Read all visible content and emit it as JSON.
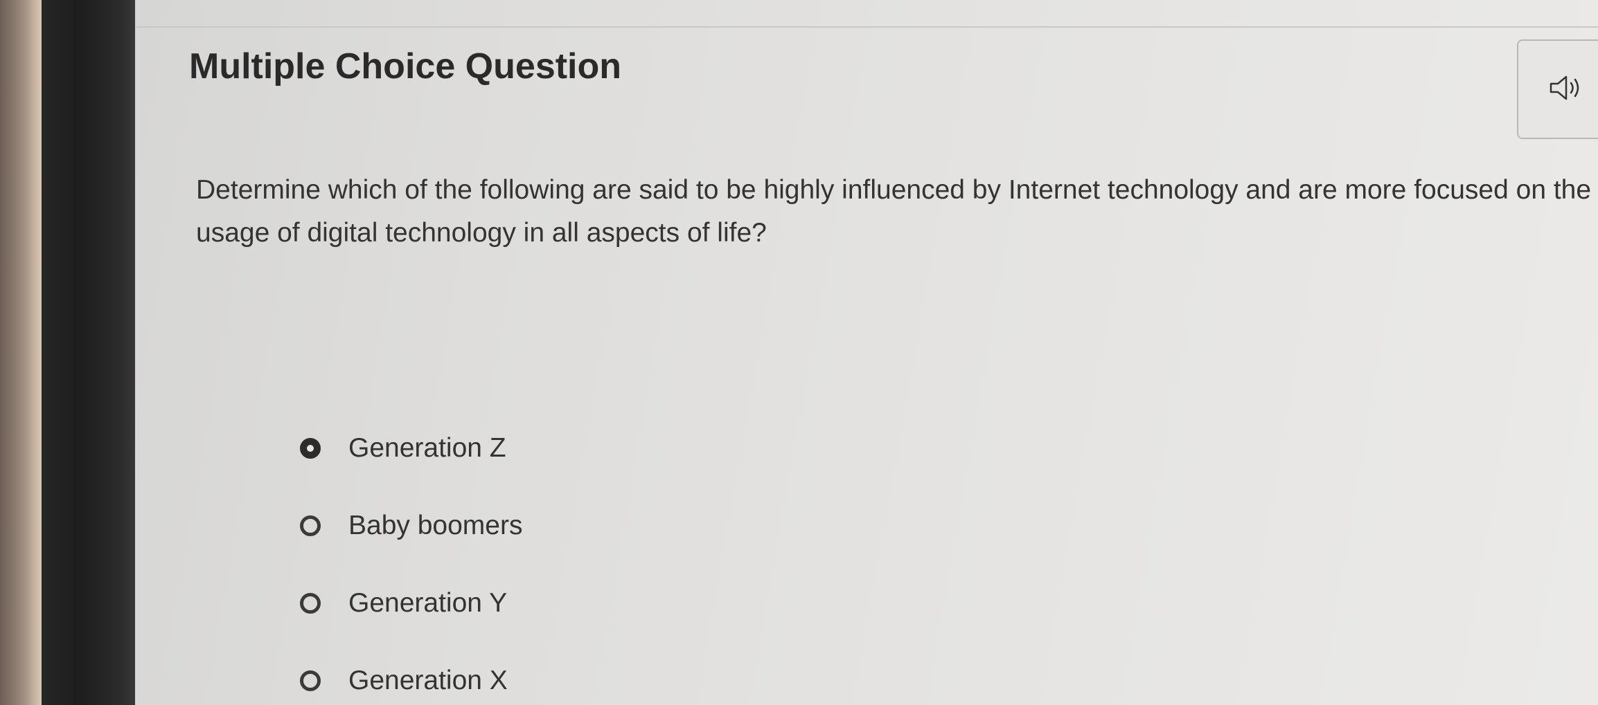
{
  "header": {
    "title": "Multiple Choice Question"
  },
  "audio": {
    "icon": "speaker-icon"
  },
  "question": {
    "text": "Determine which of the following are said to be highly influenced by Internet technology and are more focused on the usage of digital technology in all aspects of life?"
  },
  "options": [
    {
      "label": "Generation Z",
      "selected": true
    },
    {
      "label": "Baby boomers",
      "selected": false
    },
    {
      "label": "Generation Y",
      "selected": false
    },
    {
      "label": "Generation X",
      "selected": false
    }
  ]
}
